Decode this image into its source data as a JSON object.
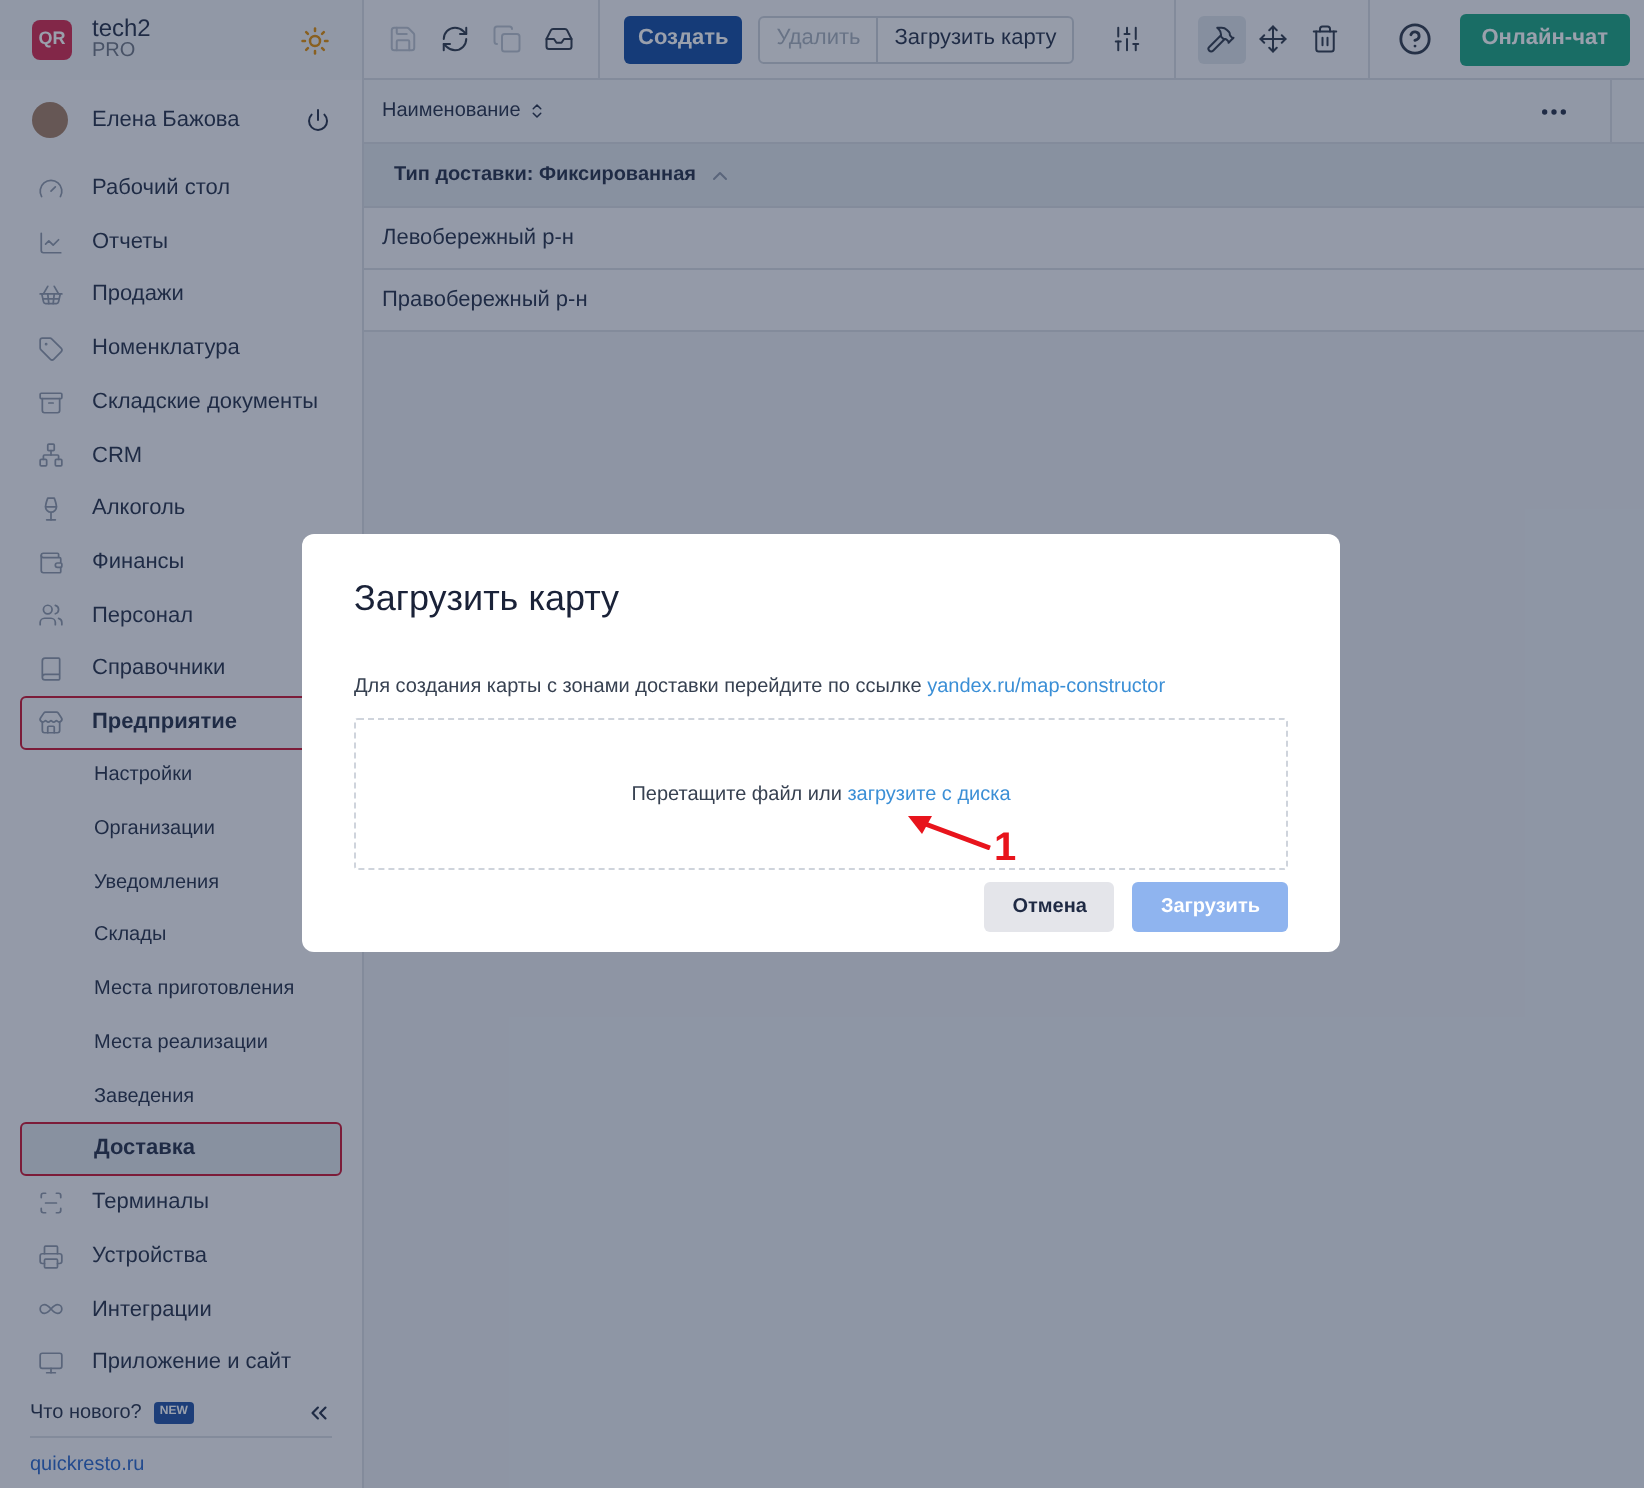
{
  "sidebar": {
    "brand": {
      "logo": "QR",
      "name": "tech2",
      "plan": "PRO"
    },
    "user": {
      "name": "Елена Бажова"
    },
    "items": [
      {
        "label": "Рабочий стол",
        "highlighted": false
      },
      {
        "label": "Отчеты",
        "highlighted": false
      },
      {
        "label": "Продажи",
        "highlighted": false
      },
      {
        "label": "Номенклатура",
        "highlighted": false
      },
      {
        "label": "Складские документы",
        "highlighted": false
      },
      {
        "label": "CRM",
        "highlighted": false
      },
      {
        "label": "Алкоголь",
        "highlighted": false
      },
      {
        "label": "Финансы",
        "highlighted": false
      },
      {
        "label": "Персонал",
        "highlighted": false
      },
      {
        "label": "Справочники",
        "highlighted": false
      },
      {
        "label": "Предприятие",
        "highlighted": true,
        "children": [
          {
            "label": "Настройки",
            "selected": false,
            "highlighted": false
          },
          {
            "label": "Организации",
            "selected": false,
            "highlighted": false
          },
          {
            "label": "Уведомления",
            "selected": false,
            "highlighted": false
          },
          {
            "label": "Склады",
            "selected": false,
            "highlighted": false
          },
          {
            "label": "Места приготовления",
            "selected": false,
            "highlighted": false
          },
          {
            "label": "Места реализации",
            "selected": false,
            "highlighted": false
          },
          {
            "label": "Заведения",
            "selected": false,
            "highlighted": false
          },
          {
            "label": "Доставка",
            "selected": true,
            "highlighted": true
          }
        ]
      },
      {
        "label": "Терминалы",
        "highlighted": false
      },
      {
        "label": "Устройства",
        "highlighted": false
      },
      {
        "label": "Интеграции",
        "highlighted": false
      },
      {
        "label": "Приложение и сайт",
        "highlighted": false
      }
    ],
    "whats_new": {
      "label": "Что нового?",
      "badge": "NEW"
    },
    "footer_link": "quickresto.ru"
  },
  "toolbar": {
    "icons": [
      {
        "disabled": true
      },
      {
        "disabled": false
      },
      {
        "disabled": true
      },
      {
        "disabled": false
      }
    ],
    "create": "Создать",
    "delete": {
      "label": "Удалить",
      "disabled": true
    },
    "upload": "Загрузить карту",
    "tools": [
      {
        "selected": false
      },
      {
        "selected": true
      },
      {
        "selected": false
      },
      {
        "selected": false
      }
    ],
    "chat": "Онлайн-чат"
  },
  "table": {
    "columns": [
      "Наименование"
    ],
    "group": {
      "label": "Тип доставки: Фиксированная",
      "expanded": true
    },
    "rows": [
      "Левобережный р-н",
      "Правобережный р-н"
    ]
  },
  "dialog": {
    "title": "Загрузить карту",
    "text": "Для создания карты с зонами доставки перейдите по ссылке",
    "link": "yandex.ru/map-constructor",
    "dropzone": {
      "text": "Перетащите файл или",
      "link": "загрузите с диска"
    },
    "buttons": [
      {
        "label": "Отмена",
        "kind": "secondary"
      },
      {
        "label": "Загрузить",
        "kind": "primary",
        "disabled": true
      }
    ]
  },
  "annotation": {
    "label": "1"
  }
}
